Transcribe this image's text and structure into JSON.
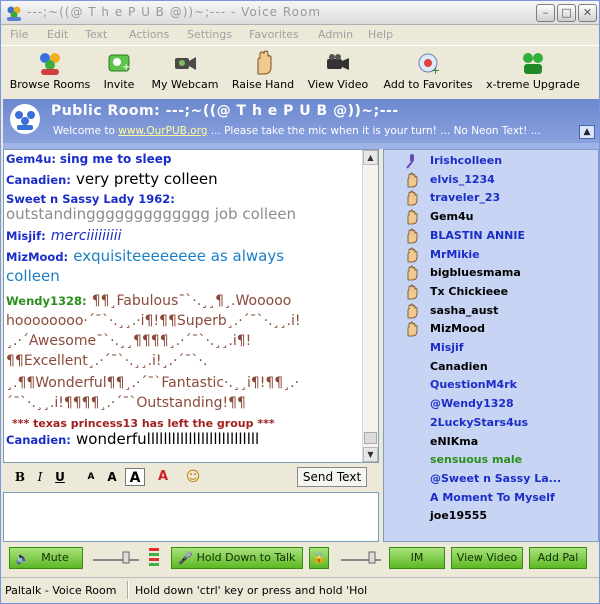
{
  "window": {
    "title": "---;~((@  T h e  P U B  @))~;---  - Voice Room"
  },
  "menu": [
    "File",
    "Edit",
    "Text",
    "Actions",
    "Settings",
    "Favorites",
    "Admin",
    "Help"
  ],
  "toolbar": {
    "browse": "Browse Rooms",
    "invite": "Invite",
    "webcam": "My Webcam",
    "raise": "Raise Hand",
    "video": "View Video",
    "favorites": "Add to Favorites",
    "upgrade": "x-treme Upgrade"
  },
  "room": {
    "title": "Public Room: ---;~((@  T h e  P U B  @))~;---",
    "welcome_pre": "Welcome to ",
    "welcome_link": "www.OurPUB.org",
    "welcome_post": " ... Please take the mic when it is your turn! ... No Neon Text! ..."
  },
  "chat": [
    {
      "nick": "Gem4u:",
      "text": "sing me to sleep",
      "nick_color": "#1a2dc8",
      "text_color": "#1a2dc8"
    },
    {
      "nick": "Canadien:",
      "text": "very pretty colleen",
      "nick_color": "#1a2dc8",
      "text_color": "#000000"
    },
    {
      "nick": "Sweet n Sassy Lady 1962:",
      "text": "",
      "nick_color": "#1a2dc8",
      "text_color": "#000000"
    },
    {
      "nick": "",
      "text": "outstandinggggggggggggg job colleen",
      "nick_color": "#1a2dc8",
      "text_color": "#8c8c8c"
    },
    {
      "nick": "Misjif:",
      "text": "merciiiiiiiii",
      "nick_color": "#1a2dc8",
      "text_color": "#1a2dc8"
    },
    {
      "nick": "MizMood:",
      "text": "exquisiteeeeeeee as always",
      "nick_color": "#1a2dc8",
      "text_color": "#1b7fc4"
    },
    {
      "nick": "",
      "text": "colleen",
      "nick_color": "#1a2dc8",
      "text_color": "#1b7fc4"
    },
    {
      "nick": "Wendy1328:",
      "text": "¶¶¸Fabulous¯`·.¸¸¶¸.Wooooo",
      "nick_color": "#2a8f1b",
      "text_color": "#8b4a3a"
    },
    {
      "nick": "",
      "text": "hoooooooo·´¯`·.¸¸.·i¶!¶¶Superb¸.·´¯`·.¸¸.i!",
      "nick_color": "#2a8f1b",
      "text_color": "#8b4a3a"
    },
    {
      "nick": "",
      "text": "¸.·´Awesome¯`·.¸¸¶¶¶¶¸.·´¯`·.¸¸.i¶!",
      "nick_color": "#2a8f1b",
      "text_color": "#8b4a3a"
    },
    {
      "nick": "",
      "text": "¶¶Excellent¸.·´¯`·.¸¸.i!¸.·´¯`·.",
      "nick_color": "#2a8f1b",
      "text_color": "#8b4a3a"
    },
    {
      "nick": "",
      "text": "¸.¶¶Wonderful¶¶¸.·´¯`Fantastic·.¸¸i¶!¶¶¸.·",
      "nick_color": "#2a8f1b",
      "text_color": "#8b4a3a"
    },
    {
      "nick": "",
      "text": "´¯`·.¸¸.i!¶¶¶¶¸.·´¯`Outstanding!¶¶",
      "nick_color": "#2a8f1b",
      "text_color": "#8b4a3a"
    },
    {
      "nick": "",
      "text": "*** texas princess13 has left the group ***",
      "nick_color": "#a02020",
      "text_color": "#a02020"
    },
    {
      "nick": "Canadien:",
      "text": "wonderfulllllllllllllllllllllllllll",
      "nick_color": "#1a2dc8",
      "text_color": "#000000"
    }
  ],
  "format": {
    "bold": "B",
    "italic": "I",
    "underline": "U",
    "small": "A",
    "medium": "A",
    "large": "A",
    "color": "A",
    "emoticon": "☺",
    "send": "Send Text"
  },
  "users": [
    {
      "name": "Irishcolleen",
      "color": "#1a2dc8",
      "icon": "mic-icon"
    },
    {
      "name": "elvis_1234",
      "color": "#1a2dc8",
      "icon": "hand-icon"
    },
    {
      "name": "traveler_23",
      "color": "#1a2dc8",
      "icon": "hand-icon"
    },
    {
      "name": "Gem4u",
      "color": "#000000",
      "icon": "hand-icon"
    },
    {
      "name": "BLASTIN ANNIE",
      "color": "#1a2dc8",
      "icon": "hand-icon"
    },
    {
      "name": "MrMikie",
      "color": "#1a2dc8",
      "icon": "hand-icon"
    },
    {
      "name": "bigbluesmama",
      "color": "#000000",
      "icon": "hand-icon"
    },
    {
      "name": "Tx Chickieee",
      "color": "#000000",
      "icon": "hand-icon"
    },
    {
      "name": "sasha_aust",
      "color": "#000000",
      "icon": "hand-icon"
    },
    {
      "name": "MizMood",
      "color": "#000000",
      "icon": "hand-icon"
    },
    {
      "name": "Misjif",
      "color": "#1a2dc8",
      "icon": ""
    },
    {
      "name": "Canadien",
      "color": "#000000",
      "icon": ""
    },
    {
      "name": "QuestionM4rk",
      "color": "#1a2dc8",
      "icon": ""
    },
    {
      "name": "@Wendy1328",
      "color": "#1a2dc8",
      "icon": ""
    },
    {
      "name": "2LuckyStars4us",
      "color": "#1a2dc8",
      "icon": ""
    },
    {
      "name": "eNIKma",
      "color": "#000000",
      "icon": ""
    },
    {
      "name": "sensuous male",
      "color": "#2a8f1b",
      "icon": ""
    },
    {
      "name": "@Sweet n Sassy La...",
      "color": "#1a2dc8",
      "icon": ""
    },
    {
      "name": "A Moment To Myself",
      "color": "#1a2dc8",
      "icon": ""
    },
    {
      "name": "joe19555",
      "color": "#000000",
      "icon": ""
    }
  ],
  "controls": {
    "mute": "Mute",
    "talk": "Hold Down to Talk",
    "im": "IM",
    "view_video": "View Video",
    "add_pal": "Add Pal"
  },
  "status": {
    "left": "Paltalk  - Voice Room",
    "right": "Hold down 'ctrl' key or press and hold 'Hol"
  }
}
